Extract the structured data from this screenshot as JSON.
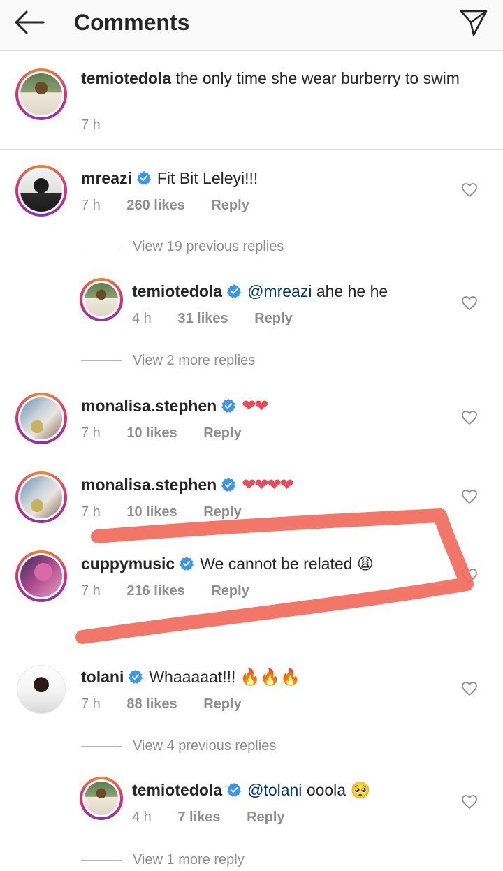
{
  "header": {
    "title": "Comments",
    "back_icon": "arrow-left-icon",
    "send_icon": "paper-plane-icon"
  },
  "colors": {
    "accent_link": "#00376b",
    "muted": "#8e8e8e",
    "verified": "#3897f0",
    "annotation": "#f26b5b"
  },
  "caption": {
    "username": "temiotedola",
    "text": "the only time she wear burberry to swim",
    "time": "7 h"
  },
  "comments": [
    {
      "username": "mreazi",
      "verified": true,
      "text": "Fit Bit Leleyi!!!",
      "time": "7 h",
      "likes": "260 likes",
      "reply": "Reply"
    },
    {
      "username": "temiotedola",
      "verified": true,
      "mention": "@mreazi",
      "text": "ahe he he",
      "time": "4 h",
      "likes": "31 likes",
      "reply": "Reply"
    },
    {
      "username": "monalisa.stephen",
      "verified": true,
      "text": "❤❤",
      "time": "7 h",
      "likes": "10 likes",
      "reply": "Reply"
    },
    {
      "username": "monalisa.stephen",
      "verified": true,
      "text": "❤❤❤❤",
      "time": "7 h",
      "likes": "10 likes",
      "reply": "Reply"
    },
    {
      "username": "cuppymusic",
      "verified": true,
      "text": "We cannot be related",
      "emoji": "😩",
      "time": "7 h",
      "likes": "216 likes",
      "reply": "Reply"
    },
    {
      "username": "tolani",
      "verified": true,
      "text": "Whaaaaat!!!",
      "emoji": "🔥🔥🔥",
      "time": "7 h",
      "likes": "88 likes",
      "reply": "Reply"
    },
    {
      "username": "temiotedola",
      "verified": true,
      "mention": "@tolani",
      "text": "ooola",
      "emoji": "🥺",
      "time": "4 h",
      "likes": "7 likes",
      "reply": "Reply"
    }
  ],
  "view_links": {
    "mreazi_previous": "View 19 previous replies",
    "mreazi_more": "View 2 more replies",
    "tolani_previous": "View 4 previous replies",
    "tolani_more": "View 1 more reply"
  }
}
